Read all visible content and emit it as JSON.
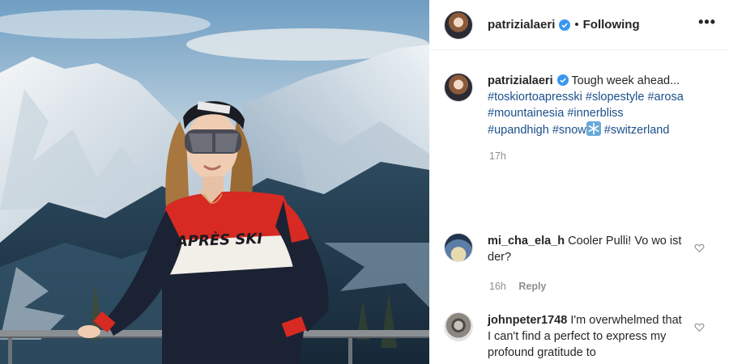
{
  "post": {
    "username": "patrizialaeri",
    "follow_status": "Following",
    "more_icon": "more-options-icon",
    "caption_text": "Tough week ahead...",
    "hashtags": [
      "#toskiortoapresski",
      "#slopestyle",
      "#arosa",
      "#mountainesia",
      "#innerbliss",
      "#upandhigh",
      "#snow",
      "#switzerland"
    ],
    "time": "17h",
    "photo_sweater_text": "APRÈS SKI"
  },
  "comments": [
    {
      "username": "mi_cha_ela_h",
      "text": "Cooler Pulli! Vo wo ist der?",
      "time": "16h",
      "reply_label": "Reply"
    },
    {
      "username": "johnpeter1748",
      "text": "I'm overwhelmed that I can't find a perfect to express my profound gratitude to",
      "time": "",
      "reply_label": ""
    }
  ],
  "colors": {
    "accent_blue": "#0095f6",
    "hashtag": "#1a4f8b",
    "muted": "#8e8e8e"
  }
}
